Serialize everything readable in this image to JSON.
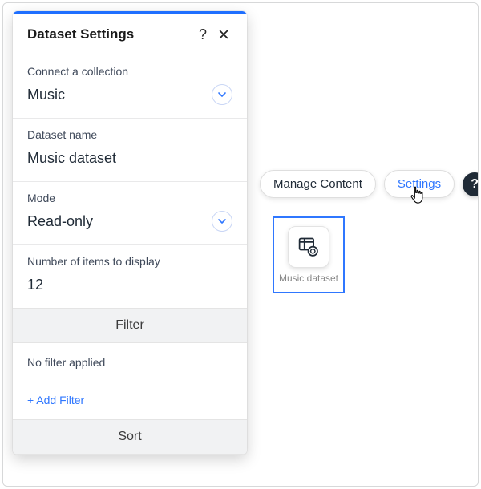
{
  "panel": {
    "title": "Dataset Settings",
    "fields": {
      "collection": {
        "label": "Connect a collection",
        "value": "Music"
      },
      "name": {
        "label": "Dataset name",
        "value": "Music dataset"
      },
      "mode": {
        "label": "Mode",
        "value": "Read-only"
      },
      "count": {
        "label": "Number of items to display",
        "value": "12"
      }
    },
    "sections": {
      "filter_header": "Filter",
      "filter_status": "No filter applied",
      "add_filter": "+ Add Filter",
      "sort_header": "Sort"
    }
  },
  "toolbar": {
    "manage_label": "Manage Content",
    "settings_label": "Settings",
    "help_glyph": "?"
  },
  "canvas": {
    "item_label": "Music dataset"
  }
}
